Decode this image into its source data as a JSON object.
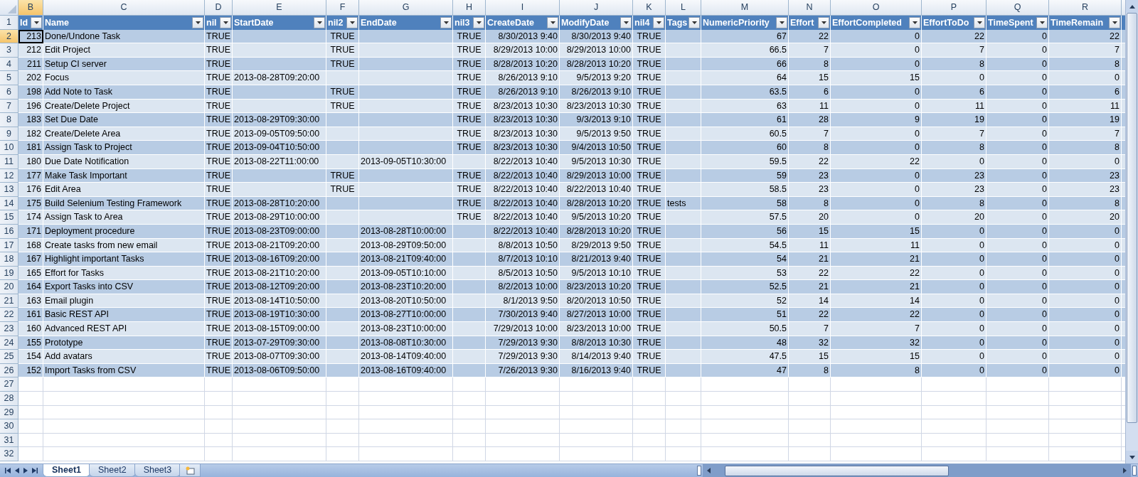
{
  "column_letters": [
    {
      "label": "B",
      "selected": true
    },
    {
      "label": "C",
      "selected": false
    },
    {
      "label": "D",
      "selected": false
    },
    {
      "label": "E",
      "selected": false
    },
    {
      "label": "F",
      "selected": false
    },
    {
      "label": "G",
      "selected": false
    },
    {
      "label": "H",
      "selected": false
    },
    {
      "label": "I",
      "selected": false
    },
    {
      "label": "J",
      "selected": false
    },
    {
      "label": "K",
      "selected": false
    },
    {
      "label": "L",
      "selected": false
    },
    {
      "label": "M",
      "selected": false
    },
    {
      "label": "N",
      "selected": false
    },
    {
      "label": "O",
      "selected": false
    },
    {
      "label": "P",
      "selected": false
    },
    {
      "label": "Q",
      "selected": false
    },
    {
      "label": "R",
      "selected": false
    }
  ],
  "row_numbers": [
    {
      "label": "1",
      "selected": false
    },
    {
      "label": "2",
      "selected": true
    },
    {
      "label": "3",
      "selected": false
    },
    {
      "label": "4",
      "selected": false
    },
    {
      "label": "5",
      "selected": false
    },
    {
      "label": "6",
      "selected": false
    },
    {
      "label": "7",
      "selected": false
    },
    {
      "label": "8",
      "selected": false
    },
    {
      "label": "9",
      "selected": false
    },
    {
      "label": "10",
      "selected": false
    },
    {
      "label": "11",
      "selected": false
    },
    {
      "label": "12",
      "selected": false
    },
    {
      "label": "13",
      "selected": false
    },
    {
      "label": "14",
      "selected": false
    },
    {
      "label": "15",
      "selected": false
    },
    {
      "label": "16",
      "selected": false
    },
    {
      "label": "17",
      "selected": false
    },
    {
      "label": "18",
      "selected": false
    },
    {
      "label": "19",
      "selected": false
    },
    {
      "label": "20",
      "selected": false
    },
    {
      "label": "21",
      "selected": false
    },
    {
      "label": "22",
      "selected": false
    },
    {
      "label": "23",
      "selected": false
    },
    {
      "label": "24",
      "selected": false
    },
    {
      "label": "25",
      "selected": false
    },
    {
      "label": "26",
      "selected": false
    },
    {
      "label": "27",
      "selected": false
    },
    {
      "label": "28",
      "selected": false
    },
    {
      "label": "29",
      "selected": false
    },
    {
      "label": "30",
      "selected": false
    },
    {
      "label": "31",
      "selected": false
    },
    {
      "label": "32",
      "selected": false
    }
  ],
  "table": {
    "columns": [
      {
        "header": "Id",
        "kind": "number"
      },
      {
        "header": "Name",
        "kind": "text"
      },
      {
        "header": "nil",
        "kind": "bool"
      },
      {
        "header": "StartDate",
        "kind": "text"
      },
      {
        "header": "nil2",
        "kind": "bool"
      },
      {
        "header": "EndDate",
        "kind": "text"
      },
      {
        "header": "nil3",
        "kind": "bool"
      },
      {
        "header": "CreateDate",
        "kind": "date"
      },
      {
        "header": "ModifyDate",
        "kind": "date"
      },
      {
        "header": "nil4",
        "kind": "bool"
      },
      {
        "header": "Tags",
        "kind": "text"
      },
      {
        "header": "NumericPriority",
        "kind": "number"
      },
      {
        "header": "Effort",
        "kind": "number"
      },
      {
        "header": "EffortCompleted",
        "kind": "number"
      },
      {
        "header": "EffortToDo",
        "kind": "number"
      },
      {
        "header": "TimeSpent",
        "kind": "number"
      },
      {
        "header": "TimeRemain",
        "kind": "number"
      }
    ],
    "rows": [
      [
        "213",
        "Done/Undone Task",
        "TRUE",
        null,
        "TRUE",
        null,
        "TRUE",
        "8/30/2013 9:40",
        "8/30/2013 9:40",
        "TRUE",
        null,
        "67",
        "22",
        "0",
        "22",
        "0",
        "22"
      ],
      [
        "212",
        "Edit Project",
        "TRUE",
        null,
        "TRUE",
        null,
        "TRUE",
        "8/29/2013 10:00",
        "8/29/2013 10:00",
        "TRUE",
        null,
        "66.5",
        "7",
        "0",
        "7",
        "0",
        "7"
      ],
      [
        "211",
        "Setup CI server",
        "TRUE",
        null,
        "TRUE",
        null,
        "TRUE",
        "8/28/2013 10:20",
        "8/28/2013 10:20",
        "TRUE",
        null,
        "66",
        "8",
        "0",
        "8",
        "0",
        "8"
      ],
      [
        "202",
        "Focus",
        "TRUE",
        "2013-08-28T09:20:00",
        null,
        null,
        "TRUE",
        "8/26/2013 9:10",
        "9/5/2013 9:20",
        "TRUE",
        null,
        "64",
        "15",
        "15",
        "0",
        "0",
        "0"
      ],
      [
        "198",
        "Add Note to Task",
        "TRUE",
        null,
        "TRUE",
        null,
        "TRUE",
        "8/26/2013 9:10",
        "8/26/2013 9:10",
        "TRUE",
        null,
        "63.5",
        "6",
        "0",
        "6",
        "0",
        "6"
      ],
      [
        "196",
        "Create/Delete Project",
        "TRUE",
        null,
        "TRUE",
        null,
        "TRUE",
        "8/23/2013 10:30",
        "8/23/2013 10:30",
        "TRUE",
        null,
        "63",
        "11",
        "0",
        "11",
        "0",
        "11"
      ],
      [
        "183",
        "Set Due Date",
        "TRUE",
        "2013-08-29T09:30:00",
        null,
        null,
        "TRUE",
        "8/23/2013 10:30",
        "9/3/2013 9:10",
        "TRUE",
        null,
        "61",
        "28",
        "9",
        "19",
        "0",
        "19"
      ],
      [
        "182",
        "Create/Delete Area",
        "TRUE",
        "2013-09-05T09:50:00",
        null,
        null,
        "TRUE",
        "8/23/2013 10:30",
        "9/5/2013 9:50",
        "TRUE",
        null,
        "60.5",
        "7",
        "0",
        "7",
        "0",
        "7"
      ],
      [
        "181",
        "Assign Task to Project",
        "TRUE",
        "2013-09-04T10:50:00",
        null,
        null,
        "TRUE",
        "8/23/2013 10:30",
        "9/4/2013 10:50",
        "TRUE",
        null,
        "60",
        "8",
        "0",
        "8",
        "0",
        "8"
      ],
      [
        "180",
        "Due Date Notification",
        "TRUE",
        "2013-08-22T11:00:00",
        null,
        "2013-09-05T10:30:00",
        null,
        "8/22/2013 10:40",
        "9/5/2013 10:30",
        "TRUE",
        null,
        "59.5",
        "22",
        "22",
        "0",
        "0",
        "0"
      ],
      [
        "177",
        "Make Task Important",
        "TRUE",
        null,
        "TRUE",
        null,
        "TRUE",
        "8/22/2013 10:40",
        "8/29/2013 10:00",
        "TRUE",
        null,
        "59",
        "23",
        "0",
        "23",
        "0",
        "23"
      ],
      [
        "176",
        "Edit Area",
        "TRUE",
        null,
        "TRUE",
        null,
        "TRUE",
        "8/22/2013 10:40",
        "8/22/2013 10:40",
        "TRUE",
        null,
        "58.5",
        "23",
        "0",
        "23",
        "0",
        "23"
      ],
      [
        "175",
        "Build Selenium Testing Framework",
        "TRUE",
        "2013-08-28T10:20:00",
        null,
        null,
        "TRUE",
        "8/22/2013 10:40",
        "8/28/2013 10:20",
        "TRUE",
        "tests",
        "58",
        "8",
        "0",
        "8",
        "0",
        "8"
      ],
      [
        "174",
        "Assign Task to Area",
        "TRUE",
        "2013-08-29T10:00:00",
        null,
        null,
        "TRUE",
        "8/22/2013 10:40",
        "9/5/2013 10:20",
        "TRUE",
        null,
        "57.5",
        "20",
        "0",
        "20",
        "0",
        "20"
      ],
      [
        "171",
        "Deployment procedure",
        "TRUE",
        "2013-08-23T09:00:00",
        null,
        "2013-08-28T10:00:00",
        null,
        "8/22/2013 10:40",
        "8/28/2013 10:20",
        "TRUE",
        null,
        "56",
        "15",
        "15",
        "0",
        "0",
        "0"
      ],
      [
        "168",
        "Create tasks from new email",
        "TRUE",
        "2013-08-21T09:20:00",
        null,
        "2013-08-29T09:50:00",
        null,
        "8/8/2013 10:50",
        "8/29/2013 9:50",
        "TRUE",
        null,
        "54.5",
        "11",
        "11",
        "0",
        "0",
        "0"
      ],
      [
        "167",
        "Highlight important Tasks",
        "TRUE",
        "2013-08-16T09:20:00",
        null,
        "2013-08-21T09:40:00",
        null,
        "8/7/2013 10:10",
        "8/21/2013 9:40",
        "TRUE",
        null,
        "54",
        "21",
        "21",
        "0",
        "0",
        "0"
      ],
      [
        "165",
        "Effort for Tasks",
        "TRUE",
        "2013-08-21T10:20:00",
        null,
        "2013-09-05T10:10:00",
        null,
        "8/5/2013 10:50",
        "9/5/2013 10:10",
        "TRUE",
        null,
        "53",
        "22",
        "22",
        "0",
        "0",
        "0"
      ],
      [
        "164",
        "Export Tasks into CSV",
        "TRUE",
        "2013-08-12T09:20:00",
        null,
        "2013-08-23T10:20:00",
        null,
        "8/2/2013 10:00",
        "8/23/2013 10:20",
        "TRUE",
        null,
        "52.5",
        "21",
        "21",
        "0",
        "0",
        "0"
      ],
      [
        "163",
        "Email plugin",
        "TRUE",
        "2013-08-14T10:50:00",
        null,
        "2013-08-20T10:50:00",
        null,
        "8/1/2013 9:50",
        "8/20/2013 10:50",
        "TRUE",
        null,
        "52",
        "14",
        "14",
        "0",
        "0",
        "0"
      ],
      [
        "161",
        "Basic REST API",
        "TRUE",
        "2013-08-19T10:30:00",
        null,
        "2013-08-27T10:00:00",
        null,
        "7/30/2013 9:40",
        "8/27/2013 10:00",
        "TRUE",
        null,
        "51",
        "22",
        "22",
        "0",
        "0",
        "0"
      ],
      [
        "160",
        "Advanced REST API",
        "TRUE",
        "2013-08-15T09:00:00",
        null,
        "2013-08-23T10:00:00",
        null,
        "7/29/2013 10:00",
        "8/23/2013 10:00",
        "TRUE",
        null,
        "50.5",
        "7",
        "7",
        "0",
        "0",
        "0"
      ],
      [
        "155",
        "Prototype",
        "TRUE",
        "2013-07-29T09:30:00",
        null,
        "2013-08-08T10:30:00",
        null,
        "7/29/2013 9:30",
        "8/8/2013 10:30",
        "TRUE",
        null,
        "48",
        "32",
        "32",
        "0",
        "0",
        "0"
      ],
      [
        "154",
        "Add avatars",
        "TRUE",
        "2013-08-07T09:30:00",
        null,
        "2013-08-14T09:40:00",
        null,
        "7/29/2013 9:30",
        "8/14/2013 9:40",
        "TRUE",
        null,
        "47.5",
        "15",
        "15",
        "0",
        "0",
        "0"
      ],
      [
        "152",
        "Import Tasks from CSV",
        "TRUE",
        "2013-08-06T09:50:00",
        null,
        "2013-08-16T09:40:00",
        null,
        "7/26/2013 9:30",
        "8/16/2013 9:40",
        "TRUE",
        null,
        "47",
        "8",
        "8",
        "0",
        "0",
        "0"
      ]
    ]
  },
  "sheet_tabs": [
    {
      "label": "Sheet1",
      "selected": true
    },
    {
      "label": "Sheet2",
      "selected": false
    },
    {
      "label": "Sheet3",
      "selected": false
    }
  ]
}
